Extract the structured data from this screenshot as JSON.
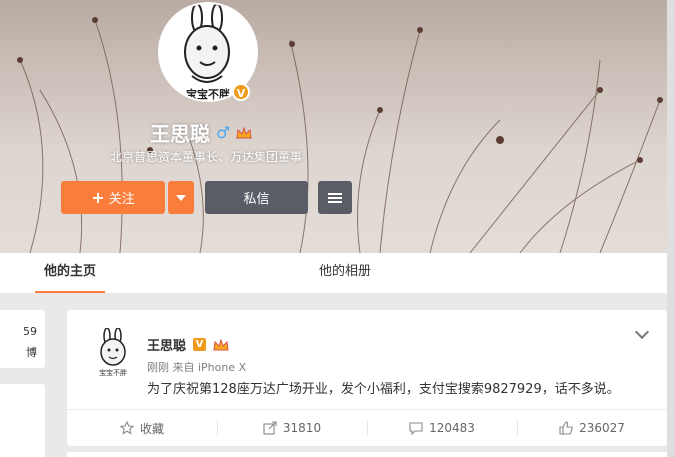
{
  "profile": {
    "avatar_caption": "宝宝不胖",
    "name": "王思聪",
    "gender_symbol": "♂",
    "bio": "北京普思资本董事长、万达集团董事",
    "verified_symbol": "V"
  },
  "actions": {
    "follow_plus": "+",
    "follow_label": "关注",
    "message_label": "私信"
  },
  "tabs": {
    "home": "他的主页",
    "album": "他的相册"
  },
  "left_card": {
    "line1": "59",
    "line2": "博"
  },
  "post": {
    "author": "王思聪",
    "verified_symbol": "V",
    "avatar_caption": "宝宝不胖",
    "meta": "刚刚 来自 iPhone X",
    "text": "为了庆祝第128座万达广场开业，发个小福利，支付宝搜索9827929，话不多说。",
    "favorite_label": "收藏",
    "repost_count": "31810",
    "comment_count": "120483",
    "like_count": "236027"
  },
  "colors": {
    "accent": "#fa7d3c",
    "button_dark": "#5a5d66",
    "verified": "#f19a1a",
    "male": "#4da6f0"
  }
}
